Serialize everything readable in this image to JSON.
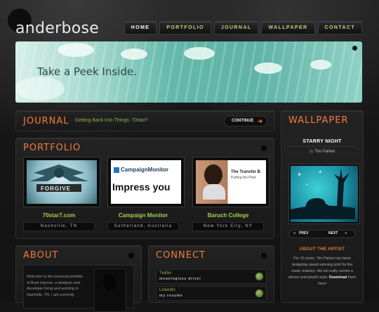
{
  "site": {
    "logo": "anderbose"
  },
  "nav": [
    {
      "label": "HOME",
      "active": true
    },
    {
      "label": "PORTFOLIO",
      "active": false
    },
    {
      "label": "JOURNAL",
      "active": false
    },
    {
      "label": "WALLPAPER",
      "active": false
    },
    {
      "label": "CONTACT",
      "active": false
    }
  ],
  "banner": {
    "text": "Take a Peek Inside."
  },
  "journal": {
    "title": "JOURNAL",
    "latest": "Getting Back Into Things: 70star7",
    "continue_label": "CONTINUE",
    "continue_icon": "arrow-right-icon"
  },
  "portfolio": {
    "title": "PORTFOLIO",
    "items": [
      {
        "title": "70star7.com",
        "location": "Nashville, TN",
        "thumb_text": "FORGIVE"
      },
      {
        "title": "Campaign Monitor",
        "location": "Sutherland, Australia",
        "thumb_brand": "CampaignMonitor",
        "thumb_text": "Impress you"
      },
      {
        "title": "Baruch College",
        "location": "New York City, NY",
        "thumb_text": "The Transfer B",
        "thumb_sub": "Putting the Pied"
      }
    ]
  },
  "about": {
    "title": "ABOUT",
    "text": "Welcome to the personal portfolio of Brad Haynes, a designer and developer living and working in Nashville, TN. I am currently"
  },
  "connect": {
    "title": "CONNECT",
    "items": [
      {
        "label": "Twitter",
        "sub": "meaningless drivel"
      },
      {
        "label": "LinkedIn",
        "sub": "my resume"
      }
    ]
  },
  "wallpaper": {
    "title": "WALLPAPER",
    "name": "STARRY NIGHT",
    "by_prefix": "by",
    "artist": "Tim Parker",
    "prev_label": "PREV",
    "next_label": "NEXT",
    "about_title": "ABOUT THE ARTIST",
    "about_text": "For 10 years, Tim Parker has been designing award-winning print for the music industry. His art really carries a vibrant and playful style.",
    "download_label": "Download",
    "download_suffix": "them here!"
  },
  "colors": {
    "accent": "#f07a3a",
    "green": "#a7cd4e",
    "teal": "#5fb3a7"
  }
}
